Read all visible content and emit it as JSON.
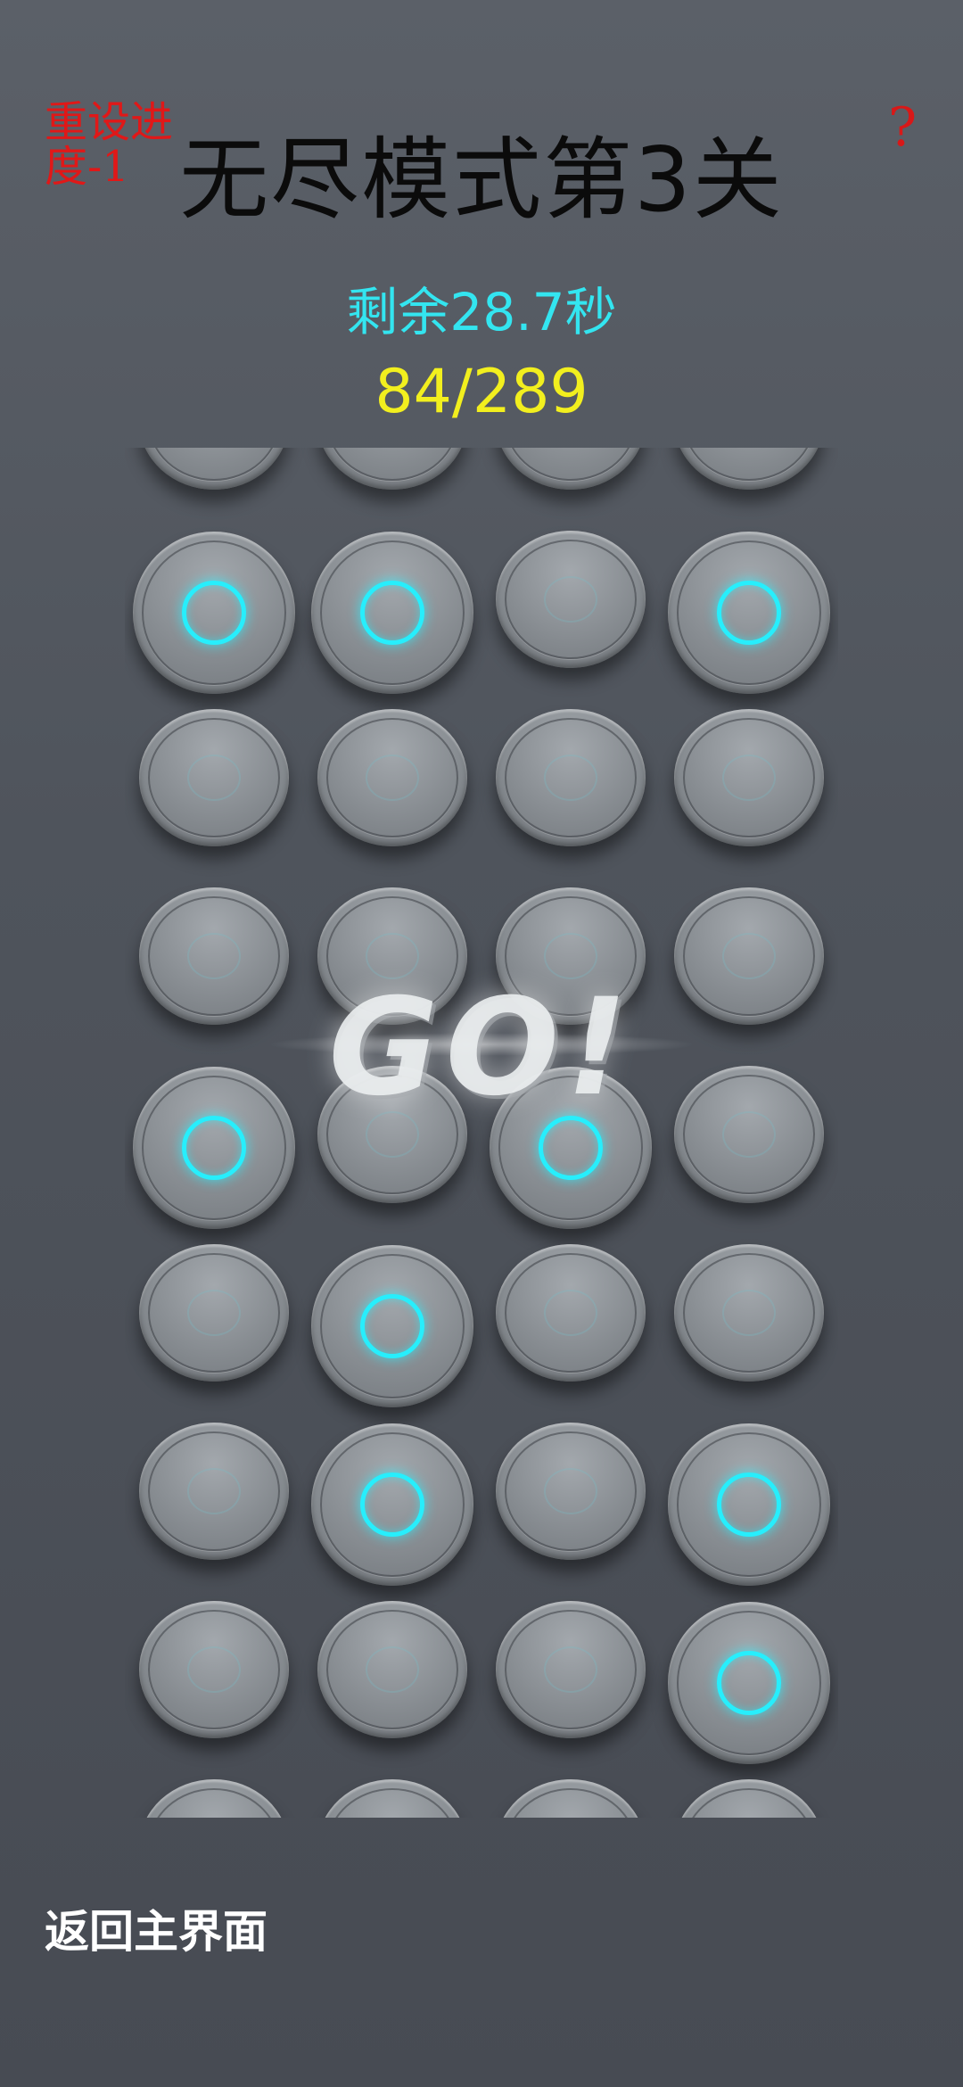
{
  "header": {
    "reset_label": "重设进度-1",
    "help_label": "?",
    "title": "无尽模式第3关",
    "timer_text": "剩余28.7秒",
    "progress_text": "84/289"
  },
  "overlay": {
    "go_text": "GO!"
  },
  "footer": {
    "back_label": "返回主界面"
  },
  "colors": {
    "lit_ring": "#27eefc",
    "timer": "#33e5f0",
    "progress": "#f2ef1e",
    "reset": "#e01818"
  },
  "board": {
    "columns": 4,
    "rows": [
      {
        "cells": [
          "off",
          "off",
          "off",
          "off"
        ]
      },
      {
        "cells": [
          "lit",
          "lit",
          "off",
          "lit"
        ]
      },
      {
        "cells": [
          "off",
          "off",
          "off",
          "off"
        ]
      },
      {
        "cells": [
          "off",
          "off",
          "off",
          "off"
        ]
      },
      {
        "cells": [
          "lit",
          "off",
          "lit",
          "off"
        ]
      },
      {
        "cells": [
          "off",
          "lit",
          "off",
          "off"
        ]
      },
      {
        "cells": [
          "off",
          "lit",
          "off",
          "lit"
        ]
      },
      {
        "cells": [
          "off",
          "off",
          "off",
          "lit"
        ]
      },
      {
        "cells": [
          "off",
          "off",
          "off",
          "off"
        ]
      }
    ]
  }
}
